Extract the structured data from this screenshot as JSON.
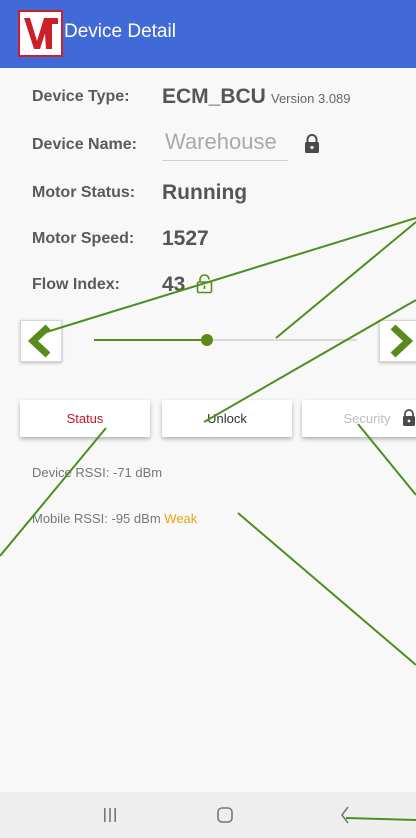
{
  "header": {
    "title": "Device Detail"
  },
  "device": {
    "type_label": "Device Type:",
    "type_value": "ECM_BCU",
    "version": "Version 3.089",
    "name_label": "Device Name:",
    "name_value": "Warehouse",
    "motor_status_label": "Motor Status:",
    "motor_status_value": "Running",
    "motor_speed_label": "Motor Speed:",
    "motor_speed_value": "1527",
    "flow_index_label": "Flow Index:",
    "flow_index_value": "43"
  },
  "slider": {
    "level_fraction": 0.43
  },
  "buttons": {
    "status": "Status",
    "unlock": "Unlock",
    "security": "Security"
  },
  "rssi": {
    "device_label": "Device RSSI:",
    "device_value": "-71",
    "device_unit": "dBm",
    "mobile_label": "Mobile RSSI:",
    "mobile_value": "-95",
    "mobile_unit": "dBm",
    "mobile_quality": "Weak"
  },
  "colors": {
    "appbar": "#4169d8",
    "accent_green": "#5a8a1c",
    "status_red": "#c0182a",
    "weak_orange": "#e8a317"
  }
}
